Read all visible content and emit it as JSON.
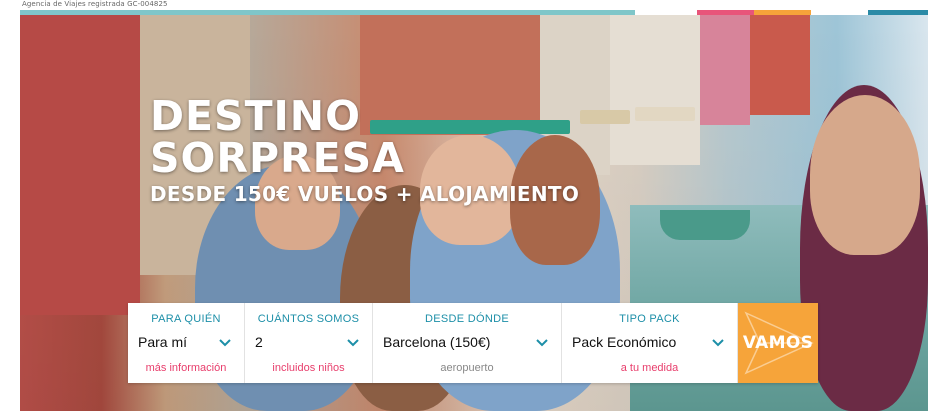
{
  "header": {
    "registration_note": "Agencia de Viajes registrada GC-004825",
    "color_bar": [
      "#7fc6c9",
      "#ffffff",
      "#e8557a",
      "#f6a43a",
      "#7fc6c9",
      "#2a8aa6"
    ]
  },
  "hero": {
    "title_line1": "DESTINO",
    "title_line2": "SORPRESA",
    "subtitle": "DESDE 150€ VUELOS + ALOJAMIENTO"
  },
  "form": {
    "fields": [
      {
        "label": "PARA QUIÉN",
        "value": "Para mí",
        "sub": "más información"
      },
      {
        "label": "CUÁNTOS SOMOS",
        "value": "2",
        "sub": "incluidos niños"
      },
      {
        "label": "DESDE DÓNDE",
        "value": "Barcelona (150€)",
        "sub": "aeropuerto"
      },
      {
        "label": "TIPO PACK",
        "value": "Pack Económico",
        "sub": "a tu medida"
      }
    ],
    "submit_label": "VAMOS"
  },
  "colors": {
    "accent_blue": "#1d8fa8",
    "accent_pink": "#e83e6c",
    "accent_orange": "#f6a43a"
  }
}
